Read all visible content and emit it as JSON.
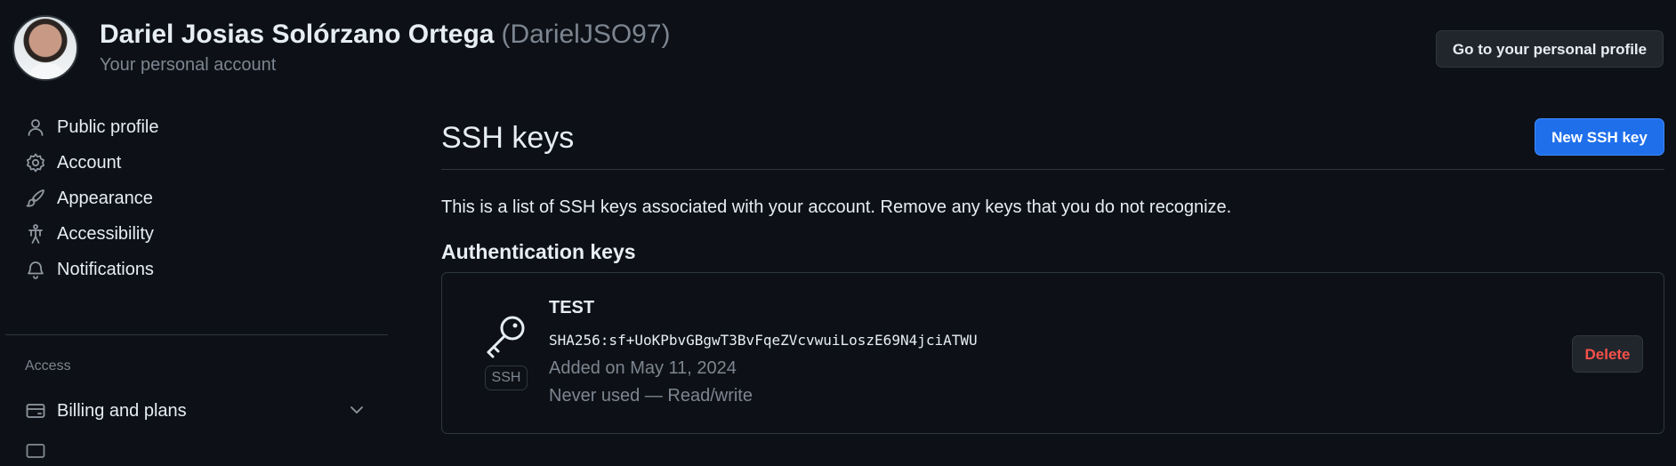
{
  "header": {
    "display_name": "Dariel Josias Solórzano Ortega",
    "username": "(DarielJSO97)",
    "account_type": "Your personal account",
    "profile_button": "Go to your personal profile"
  },
  "sidebar": {
    "items": [
      {
        "label": "Public profile",
        "icon": "person-icon"
      },
      {
        "label": "Account",
        "icon": "gear-icon"
      },
      {
        "label": "Appearance",
        "icon": "paintbrush-icon"
      },
      {
        "label": "Accessibility",
        "icon": "accessibility-icon"
      },
      {
        "label": "Notifications",
        "icon": "bell-icon"
      }
    ],
    "section_access": "Access",
    "access_items": [
      {
        "label": "Billing and plans",
        "icon": "credit-card-icon"
      }
    ]
  },
  "main": {
    "title": "SSH keys",
    "new_key_button": "New SSH key",
    "description": "This is a list of SSH keys associated with your account. Remove any keys that you do not recognize.",
    "section_heading": "Authentication keys",
    "keys": [
      {
        "name": "TEST",
        "type_badge": "SSH",
        "fingerprint": "SHA256:sf+UoKPbvGBgwT3BvFqeZVcvwuiLoszE69N4jciATWU",
        "added": "Added on May 11, 2024",
        "usage": "Never used — Read/write",
        "delete_label": "Delete"
      }
    ]
  },
  "colors": {
    "background": "#0d1117",
    "border": "#30363d",
    "text": "#e6edf3",
    "muted": "#7d8590",
    "primary": "#1f6feb",
    "danger": "#f85149"
  }
}
